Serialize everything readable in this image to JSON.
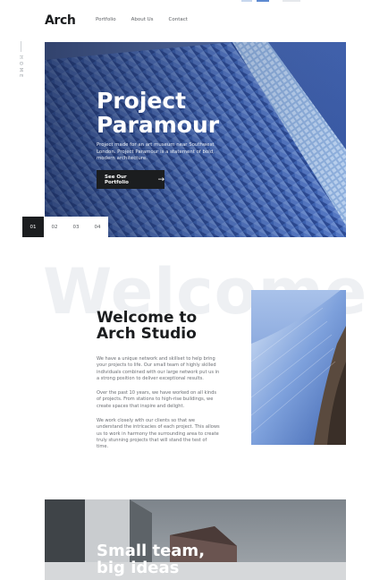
{
  "header": {
    "logo": "Arch",
    "nav": [
      "Portfolio",
      "About Us",
      "Contact"
    ]
  },
  "side": {
    "label": "HOME"
  },
  "hero": {
    "title_line1": "Project",
    "title_line2": "Paramour",
    "description": "Project made for an art museum near Southwest London. Project Paramour is a statement of bold, modern architecture.",
    "button_label": "See Our Portfolio",
    "button_icon": "arrow-right-icon"
  },
  "pager": [
    "01",
    "02",
    "03",
    "04"
  ],
  "welcome": {
    "bg_word": "Welcome",
    "title_line1": "Welcome to",
    "title_line2": "Arch Studio",
    "paragraphs": [
      "We have a unique network and skillset to help bring your projects to life. Our small team of highly skilled individuals combined with our large network put us in a strong position to deliver exceptional results.",
      "Over the past 10 years, we have worked on all kinds of projects. From stations to high-rise buildings, we create spaces that inspire and delight.",
      "We work closely with our clients so that we understand the intricacies of each project. This allows us to work in harmony the surrounding area to create truly stunning projects that will stand the test of time."
    ]
  },
  "bottom": {
    "title_line1": "Small team,",
    "title_line2": "big ideas"
  },
  "colors": {
    "dark": "#1b1d1f",
    "accent_blue": "#3b6fb8",
    "muted_text": "#6b6e73",
    "bg_word": "#eef0f3"
  }
}
